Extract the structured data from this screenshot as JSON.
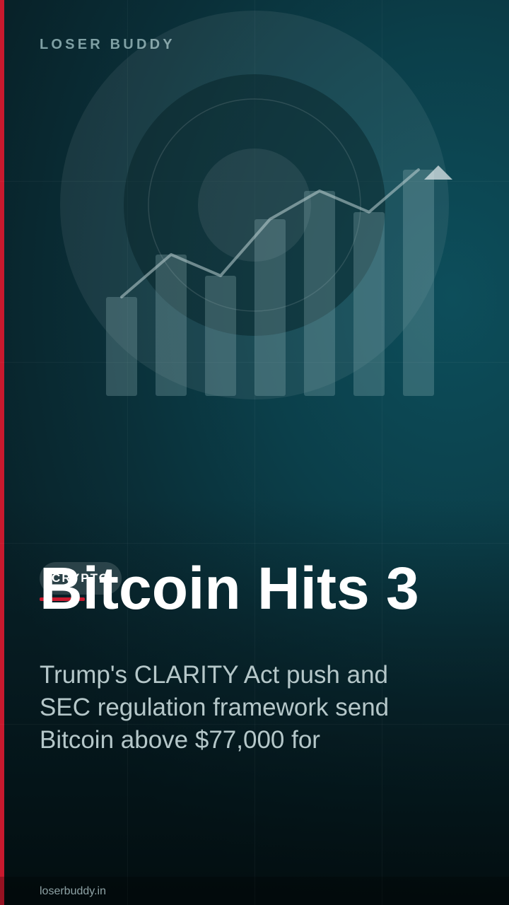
{
  "brand": {
    "name": "LOSER BUDDY",
    "accent_color": "#c8192e"
  },
  "hero": {
    "icon": "trending-chart-icon",
    "trend": "up"
  },
  "badge": {
    "label": "CRYPTO"
  },
  "headline": "Bitcoin Hits 3",
  "summary": "Trump's CLARITY Act push and SEC regulation framework send Bitcoin above $77,000 for",
  "footer": {
    "domain": "loserbuddy.in"
  },
  "colors": {
    "background": "#0b3f4a",
    "headline": "#ffffff",
    "summary": "#b5c7c9"
  }
}
